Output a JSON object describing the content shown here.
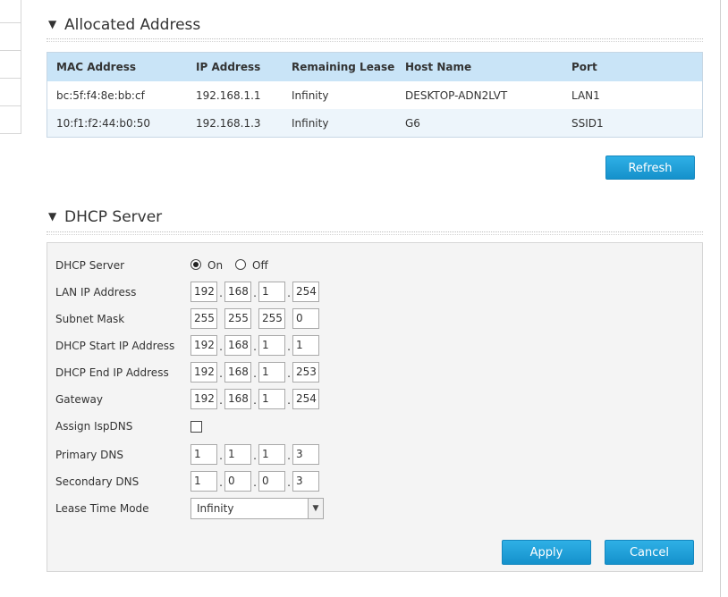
{
  "allocated": {
    "title": "Allocated Address",
    "columns": [
      "MAC Address",
      "IP Address",
      "Remaining Lease",
      "Host Name",
      "Port"
    ],
    "rows": [
      [
        "bc:5f:f4:8e:bb:cf",
        "192.168.1.1",
        "Infinity",
        "DESKTOP-ADN2LVT",
        "LAN1"
      ],
      [
        "10:f1:f2:44:b0:50",
        "192.168.1.3",
        "Infinity",
        "G6",
        "SSID1"
      ]
    ],
    "refresh_label": "Refresh"
  },
  "dhcp": {
    "title": "DHCP Server",
    "server_label": "DHCP Server",
    "on_label": "On",
    "off_label": "Off",
    "server_enabled": true,
    "lan_ip_label": "LAN IP Address",
    "lan_ip": [
      "192",
      "168",
      "1",
      "254"
    ],
    "subnet_label": "Subnet Mask",
    "subnet": [
      "255",
      "255",
      "255",
      "0"
    ],
    "start_label": "DHCP Start IP Address",
    "start_ip": [
      "192",
      "168",
      "1",
      "1"
    ],
    "end_label": "DHCP End IP Address",
    "end_ip": [
      "192",
      "168",
      "1",
      "253"
    ],
    "gateway_label": "Gateway",
    "gateway": [
      "192",
      "168",
      "1",
      "254"
    ],
    "isp_dns_label": "Assign IspDNS",
    "isp_dns_checked": false,
    "primary_dns_label": "Primary DNS",
    "primary_dns": [
      "1",
      "1",
      "1",
      "3"
    ],
    "secondary_dns_label": "Secondary DNS",
    "secondary_dns": [
      "1",
      "0",
      "0",
      "3"
    ],
    "lease_label": "Lease Time Mode",
    "lease_value": "Infinity",
    "apply_label": "Apply",
    "cancel_label": "Cancel"
  },
  "section_arrow": "▼"
}
